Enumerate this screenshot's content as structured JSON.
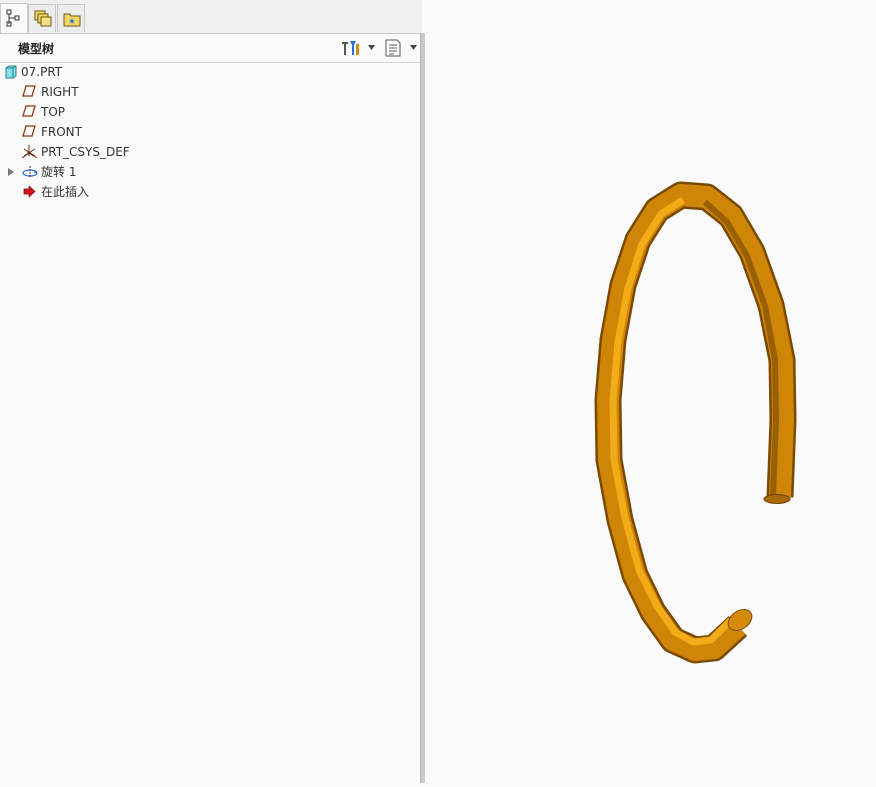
{
  "tabs": [
    {
      "name": "model-tree-tab",
      "icon": "tree-icon",
      "active": true
    },
    {
      "name": "layers-tab",
      "icon": "layers-icon",
      "active": false
    },
    {
      "name": "favorites-tab",
      "icon": "folder-star-icon",
      "active": false
    }
  ],
  "panel": {
    "title": "模型树",
    "settings_icon": "tools-icon",
    "show_icon": "list-icon"
  },
  "tree": {
    "root": {
      "label": "07.PRT",
      "icon": "part-icon"
    },
    "items": [
      {
        "label": "RIGHT",
        "icon": "datum-plane-icon"
      },
      {
        "label": "TOP",
        "icon": "datum-plane-icon"
      },
      {
        "label": "FRONT",
        "icon": "datum-plane-icon"
      },
      {
        "label": "PRT_CSYS_DEF",
        "icon": "coordinate-system-icon"
      },
      {
        "label": "旋转 1",
        "icon": "revolve-icon",
        "expandable": true
      },
      {
        "label": "在此插入",
        "icon": "insert-arrow-icon"
      }
    ]
  },
  "viewport": {
    "model": "open-ring-tube",
    "colors": {
      "light": "#f2a20c",
      "mid": "#d88a06",
      "dark": "#7a4a02",
      "background": "#fafafa"
    }
  }
}
